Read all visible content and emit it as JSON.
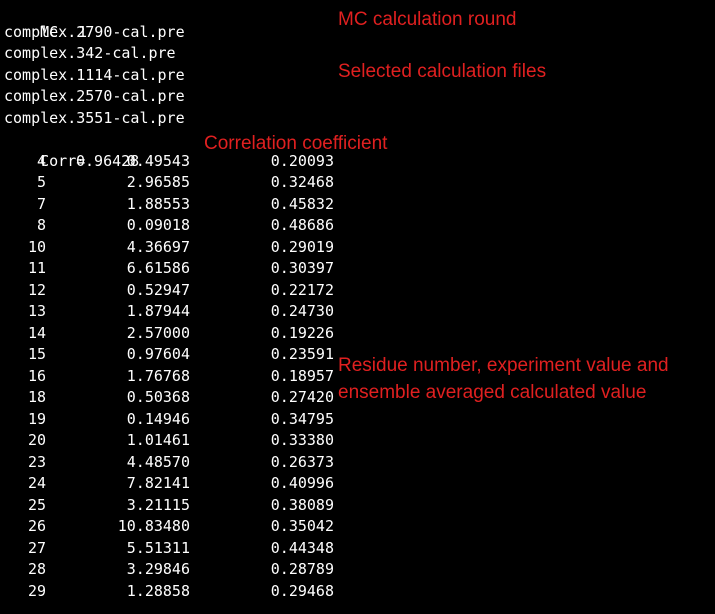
{
  "header": {
    "mc_label": "MC",
    "mc_round": "1"
  },
  "files": [
    "complex.2790-cal.pre",
    "complex.342-cal.pre",
    "complex.1114-cal.pre",
    "complex.2570-cal.pre",
    "complex.3551-cal.pre"
  ],
  "corr": {
    "label": "Corr=",
    "value": "0.96428"
  },
  "rows": [
    [
      "4",
      "0.49543",
      "0.20093"
    ],
    [
      "5",
      "2.96585",
      "0.32468"
    ],
    [
      "7",
      "1.88553",
      "0.45832"
    ],
    [
      "8",
      "0.09018",
      "0.48686"
    ],
    [
      "10",
      "4.36697",
      "0.29019"
    ],
    [
      "11",
      "6.61586",
      "0.30397"
    ],
    [
      "12",
      "0.52947",
      "0.22172"
    ],
    [
      "13",
      "1.87944",
      "0.24730"
    ],
    [
      "14",
      "2.57000",
      "0.19226"
    ],
    [
      "15",
      "0.97604",
      "0.23591"
    ],
    [
      "16",
      "1.76768",
      "0.18957"
    ],
    [
      "18",
      "0.50368",
      "0.27420"
    ],
    [
      "19",
      "0.14946",
      "0.34795"
    ],
    [
      "20",
      "1.01461",
      "0.33380"
    ],
    [
      "23",
      "4.48570",
      "0.26373"
    ],
    [
      "24",
      "7.82141",
      "0.40996"
    ],
    [
      "25",
      "3.21115",
      "0.38089"
    ],
    [
      "26",
      "10.83480",
      "0.35042"
    ],
    [
      "27",
      "5.51311",
      "0.44348"
    ],
    [
      "28",
      "3.29846",
      "0.28789"
    ],
    [
      "29",
      "1.28858",
      "0.29468"
    ]
  ],
  "annotations": {
    "mc_round": "MC calculation round",
    "selected_files": "Selected calculation files",
    "correlation": "Correlation coefficient",
    "residue_line1": "Residue number, experiment value and",
    "residue_line2": "ensemble averaged calculated value"
  },
  "colors": {
    "background": "#000000",
    "terminal_text": "#ffffff",
    "annotation": "#e02020"
  }
}
